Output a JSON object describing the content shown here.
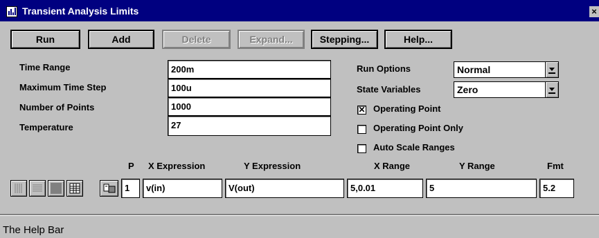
{
  "window": {
    "title": "Transient Analysis Limits",
    "close_glyph": "×"
  },
  "toolbar": {
    "run": "Run",
    "add": "Add",
    "delete": "Delete",
    "expand": "Expand...",
    "stepping": "Stepping...",
    "help": "Help..."
  },
  "limits": [
    {
      "label": "Time Range",
      "value": "200m"
    },
    {
      "label": "Maximum Time Step",
      "value": "100u"
    },
    {
      "label": "Number of Points",
      "value": "1000"
    },
    {
      "label": "Temperature",
      "value": "27"
    }
  ],
  "options": {
    "run_options_label": "Run Options",
    "run_options_value": "Normal",
    "state_variables_label": "State Variables",
    "state_variables_value": "Zero",
    "operating_point": "Operating Point",
    "operating_point_checked": true,
    "operating_point_only": "Operating Point Only",
    "operating_point_only_checked": false,
    "auto_scale": "Auto Scale Ranges",
    "auto_scale_checked": false
  },
  "columns": {
    "p": "P",
    "x_expr": "X Expression",
    "y_expr": "Y Expression",
    "x_range": "X Range",
    "y_range": "Y Range",
    "fmt": "Fmt"
  },
  "row": {
    "p": "1",
    "x_expr": "v(in)",
    "y_expr": "V(out)",
    "x_range": "5,0.01",
    "y_range": "5",
    "fmt": "5.2"
  },
  "help_bar": "The Help Bar",
  "icons": [
    "grid-vertical-icon",
    "grid-horizontal-icon",
    "solid-fill-icon",
    "table-icon",
    "clipboard-icon"
  ]
}
